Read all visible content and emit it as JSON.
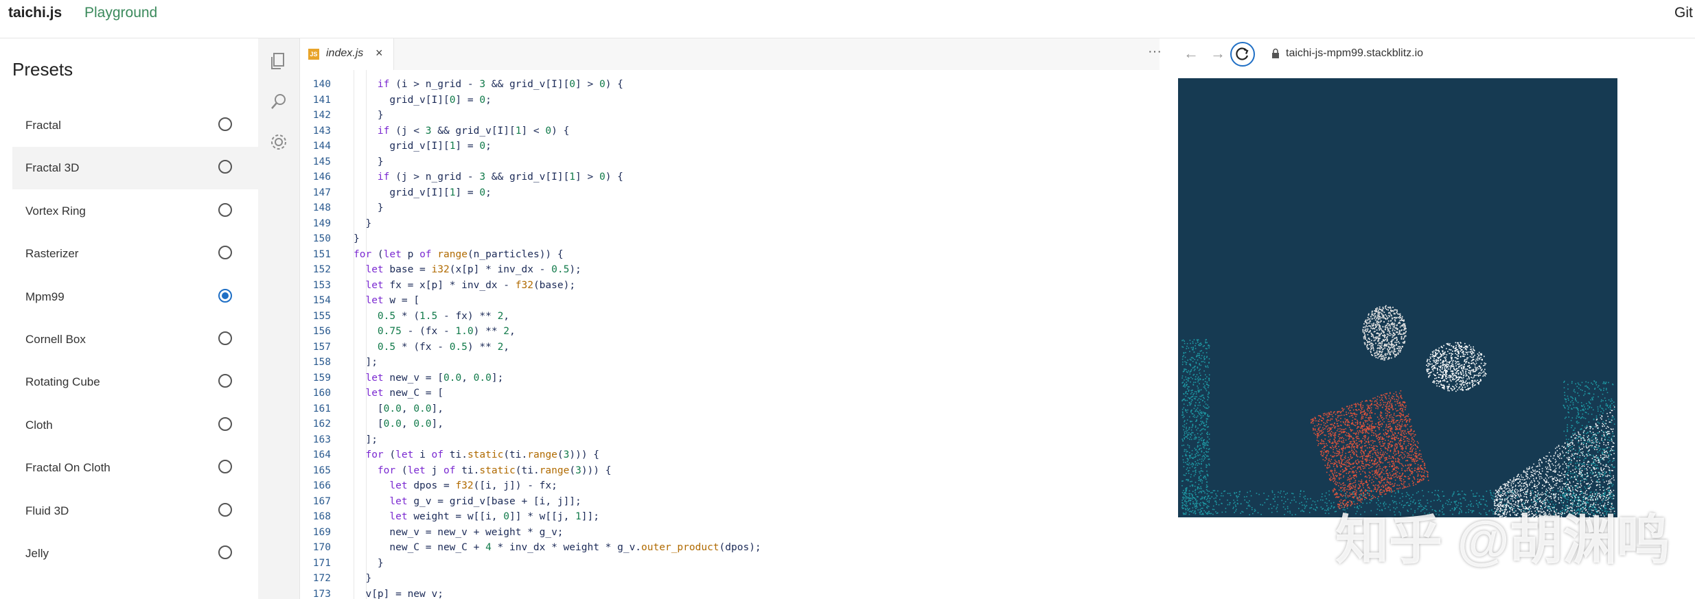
{
  "header": {
    "brand": "taichi.js",
    "playground": "Playground",
    "right_link": "Git"
  },
  "sidebar": {
    "title": "Presets",
    "items": [
      {
        "label": "Fractal",
        "selected": false
      },
      {
        "label": "Fractal 3D",
        "selected": false
      },
      {
        "label": "Vortex Ring",
        "selected": false
      },
      {
        "label": "Rasterizer",
        "selected": false
      },
      {
        "label": "Mpm99",
        "selected": true
      },
      {
        "label": "Cornell Box",
        "selected": false
      },
      {
        "label": "Rotating Cube",
        "selected": false
      },
      {
        "label": "Cloth",
        "selected": false
      },
      {
        "label": "Fractal On Cloth",
        "selected": false
      },
      {
        "label": "Fluid 3D",
        "selected": false
      },
      {
        "label": "Jelly",
        "selected": false
      }
    ]
  },
  "activity_bar": {
    "icons": [
      "files-icon",
      "search-icon",
      "gear-icon"
    ]
  },
  "editor": {
    "tab": {
      "badge": "JS",
      "filename": "index.js",
      "close": "×"
    },
    "lines": [
      {
        "n": "140",
        "code": "    if (i > n_grid - 3 && grid_v[I][0] > 0) {"
      },
      {
        "n": "141",
        "code": "      grid_v[I][0] = 0;"
      },
      {
        "n": "142",
        "code": "    }"
      },
      {
        "n": "143",
        "code": "    if (j < 3 && grid_v[I][1] < 0) {"
      },
      {
        "n": "144",
        "code": "      grid_v[I][1] = 0;"
      },
      {
        "n": "145",
        "code": "    }"
      },
      {
        "n": "146",
        "code": "    if (j > n_grid - 3 && grid_v[I][1] > 0) {"
      },
      {
        "n": "147",
        "code": "      grid_v[I][1] = 0;"
      },
      {
        "n": "148",
        "code": "    }"
      },
      {
        "n": "149",
        "code": "  }"
      },
      {
        "n": "150",
        "code": "}"
      },
      {
        "n": "151",
        "code": "for (let p of range(n_particles)) {"
      },
      {
        "n": "152",
        "code": "  let base = i32(x[p] * inv_dx - 0.5);"
      },
      {
        "n": "153",
        "code": "  let fx = x[p] * inv_dx - f32(base);"
      },
      {
        "n": "154",
        "code": "  let w = ["
      },
      {
        "n": "155",
        "code": "    0.5 * (1.5 - fx) ** 2,"
      },
      {
        "n": "156",
        "code": "    0.75 - (fx - 1.0) ** 2,"
      },
      {
        "n": "157",
        "code": "    0.5 * (fx - 0.5) ** 2,"
      },
      {
        "n": "158",
        "code": "  ];"
      },
      {
        "n": "159",
        "code": "  let new_v = [0.0, 0.0];"
      },
      {
        "n": "160",
        "code": "  let new_C = ["
      },
      {
        "n": "161",
        "code": "    [0.0, 0.0],"
      },
      {
        "n": "162",
        "code": "    [0.0, 0.0],"
      },
      {
        "n": "163",
        "code": "  ];"
      },
      {
        "n": "164",
        "code": "  for (let i of ti.static(ti.range(3))) {"
      },
      {
        "n": "165",
        "code": "    for (let j of ti.static(ti.range(3))) {"
      },
      {
        "n": "166",
        "code": "      let dpos = f32([i, j]) - fx;"
      },
      {
        "n": "167",
        "code": "      let g_v = grid_v[base + [i, j]];"
      },
      {
        "n": "168",
        "code": "      let weight = w[[i, 0]] * w[[j, 1]];"
      },
      {
        "n": "169",
        "code": "      new_v = new_v + weight * g_v;"
      },
      {
        "n": "170",
        "code": "      new_C = new_C + 4 * inv_dx * weight * g_v.outer_product(dpos);"
      },
      {
        "n": "171",
        "code": "    }"
      },
      {
        "n": "172",
        "code": "  }"
      },
      {
        "n": "173",
        "code": "  v[p] = new_v;"
      }
    ]
  },
  "browser": {
    "url": "taichi-js-mpm99.stackblitz.io",
    "more": "···",
    "back": "←",
    "forward": "→"
  },
  "colors": {
    "canvas_bg": "#163a52",
    "water": "#1e9aa5",
    "jelly": "#e0e0e0",
    "snow": "#ffffff",
    "red_block": "#e0533b"
  },
  "watermark": "知乎 @胡渊鸣"
}
